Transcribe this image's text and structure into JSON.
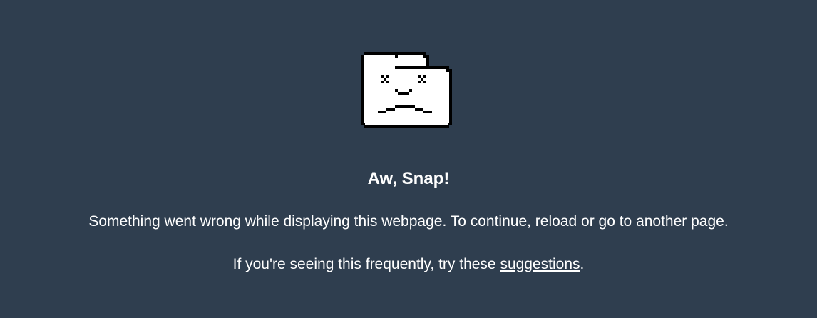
{
  "error": {
    "icon": "sad-folder-icon",
    "title": "Aw, Snap!",
    "message": "Something went wrong while displaying this webpage. To continue, reload or go to another page.",
    "hint_prefix": "If you're seeing this frequently, try these ",
    "hint_link": "suggestions",
    "hint_suffix": "."
  },
  "colors": {
    "background": "#2f3e4f",
    "text": "#ffffff",
    "icon_fill": "#ffffff",
    "icon_outline": "#000000"
  }
}
